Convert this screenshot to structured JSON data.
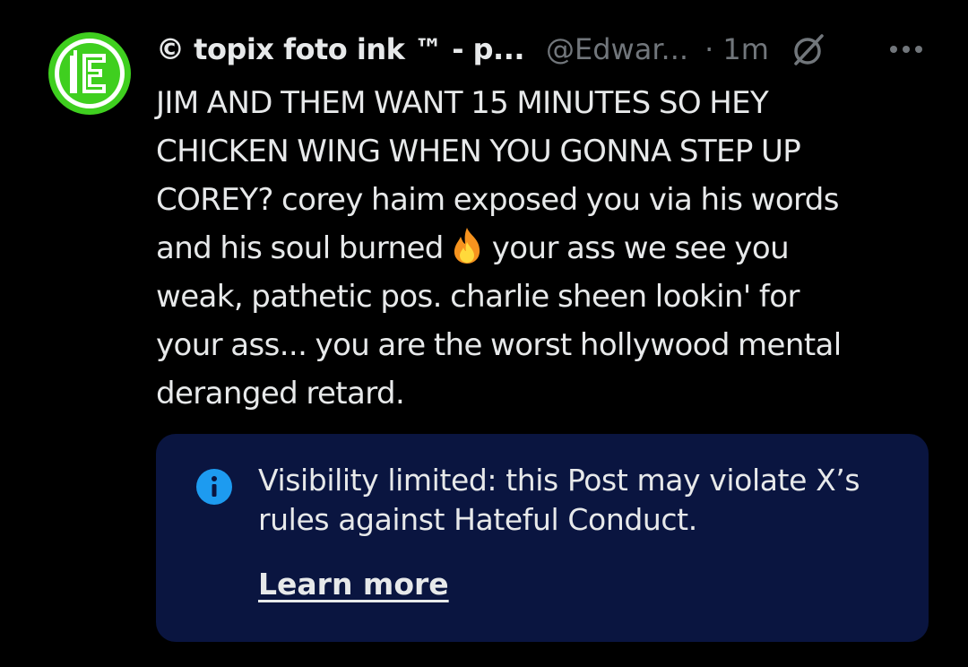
{
  "post": {
    "author": {
      "display_name": "© topix foto ink ™ - p...",
      "handle": "@Edwar...",
      "time": "· 1m",
      "avatar_icon": "green-logo-icon"
    },
    "icons": {
      "grok": "grok-icon",
      "more": "more-icon",
      "fire": "fire-emoji-icon"
    },
    "text_lines": [
      "JIM AND THEM WANT 15 MINUTES SO HEY",
      "CHICKEN WING WHEN YOU GONNA STEP UP",
      "COREY? corey haim exposed you via his words",
      "and his soul burned",
      "your ass we see you",
      "weak, pathetic pos. charlie sheen lookin' for",
      "your ass... you are the worst hollywood mental",
      "deranged retard."
    ]
  },
  "notice": {
    "line1": "Visibility limited: this Post may violate X’s",
    "line2": "rules against Hateful Conduct.",
    "learn_more": "Learn more",
    "icon": "info-icon",
    "bg_color": "#0a1540",
    "icon_color": "#1d9bf0"
  },
  "colors": {
    "background": "#000000",
    "text": "#e7e9ea",
    "muted": "#71767b",
    "avatar_green": "#3fcf1f"
  }
}
